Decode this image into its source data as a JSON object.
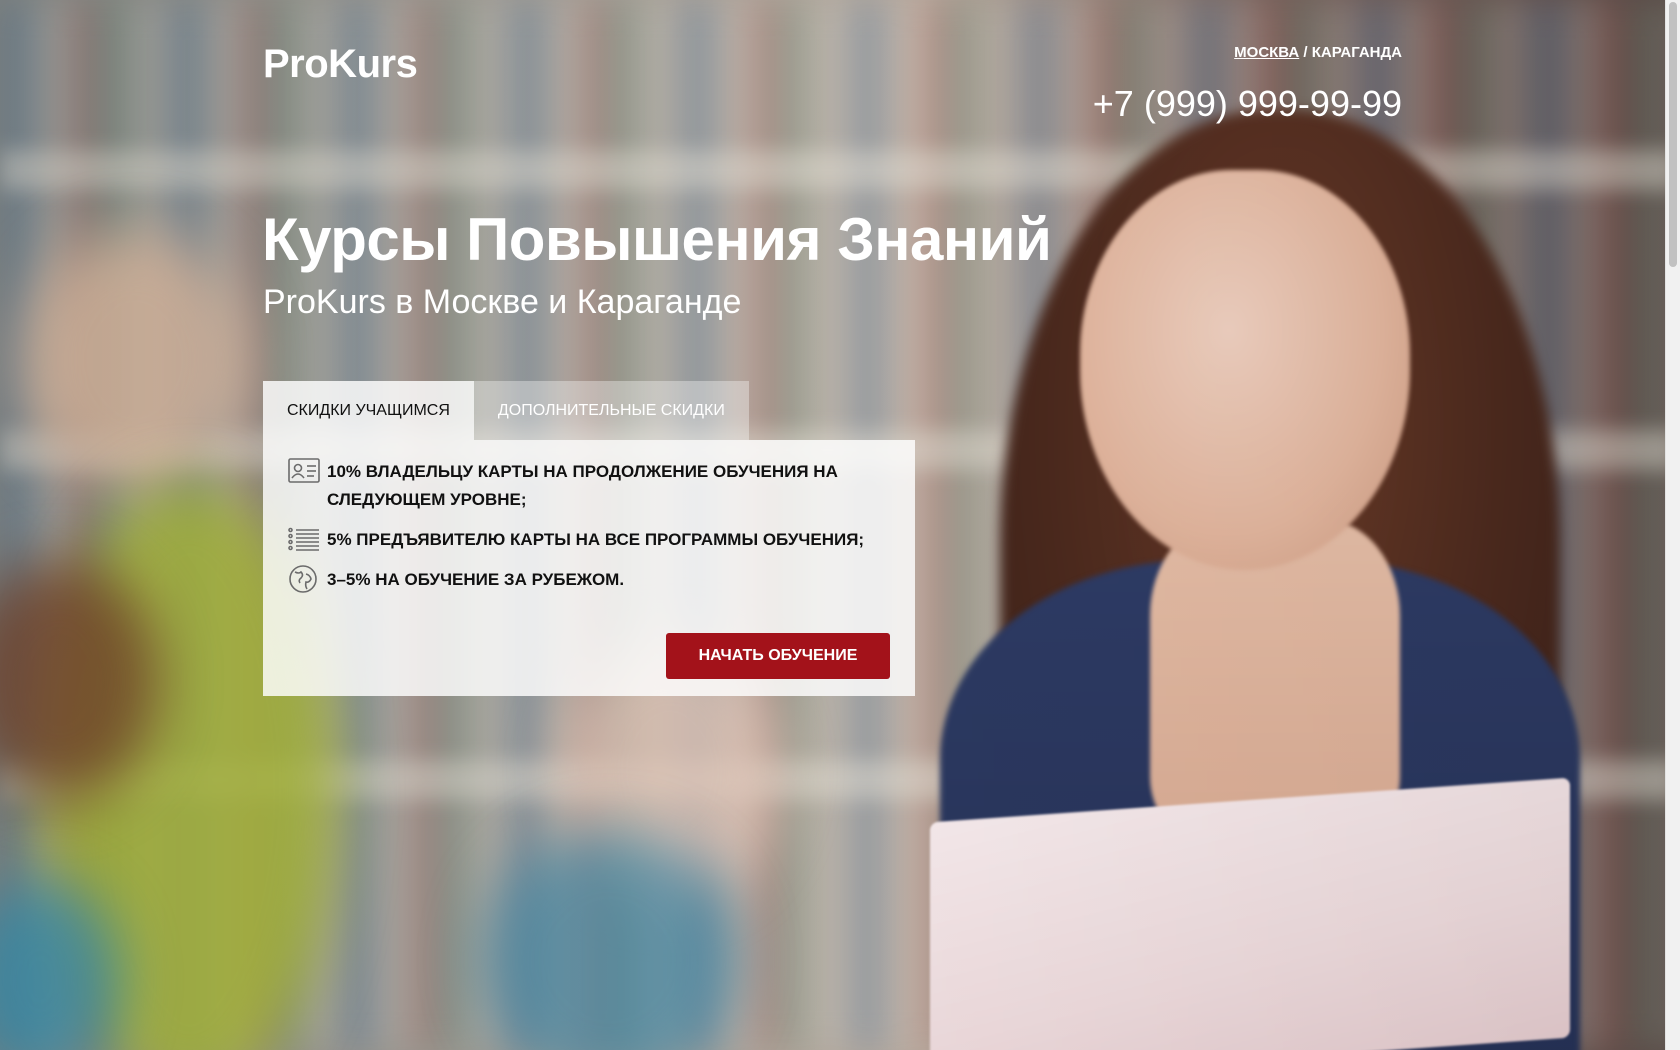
{
  "header": {
    "logo": "ProKurs",
    "city_active": "МОСКВА",
    "city_separator": "/",
    "city_other": "КАРАГАНДА",
    "phone": "+7 (999) 999-99-99"
  },
  "hero": {
    "title": "Курсы Повышения Знаний",
    "subtitle": "ProKurs в Москве и Караганде"
  },
  "tabs": [
    {
      "label": "СКИДКИ УЧАЩИМСЯ",
      "active": true
    },
    {
      "label": "ДОПОЛНИТЕЛЬНЫЕ СКИДКИ",
      "active": false
    }
  ],
  "benefits": [
    {
      "icon": "id-card-icon",
      "text": "10% ВЛАДЕЛЬЦУ КАРТЫ НА ПРОДОЛЖЕНИЕ ОБУЧЕНИЯ НА СЛЕДУЮЩЕМ УРОВНЕ;"
    },
    {
      "icon": "list-icon",
      "text": "5% ПРЕДЪЯВИТЕЛЮ КАРТЫ НА ВСЕ ПРОГРАММЫ ОБУЧЕНИЯ;"
    },
    {
      "icon": "globe-icon",
      "text": "3–5% НА ОБУЧЕНИЕ ЗА РУБЕЖОМ."
    }
  ],
  "cta": {
    "label": "НАЧАТЬ ОБУЧЕНИЕ"
  },
  "colors": {
    "cta": "#a3121a",
    "text_light": "#ffffff",
    "text_dark": "#111111"
  }
}
